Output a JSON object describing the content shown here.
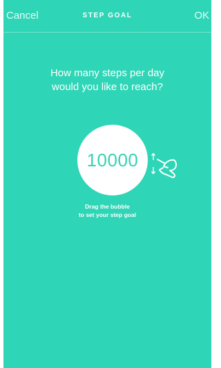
{
  "nav": {
    "cancel_label": "Cancel",
    "title": "STEP GOAL",
    "ok_label": "OK"
  },
  "prompt": {
    "line1": "How many steps per day",
    "line2": "would you like to reach?"
  },
  "bubble": {
    "value": "10000"
  },
  "hint": {
    "line1": "Drag the bubble",
    "line2": "to set your step goal"
  },
  "icons": {
    "gesture": "drag-up-down-hand-icon"
  },
  "colors": {
    "background": "#2ed5b6",
    "bubble": "#ffffff",
    "bubble_text": "#34d3b5",
    "text": "#ffffff"
  }
}
